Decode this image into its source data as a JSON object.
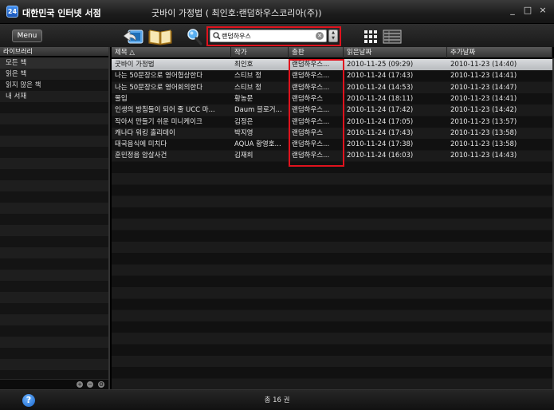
{
  "app": {
    "name": "대한민국 인터넷 서점",
    "logo_text": "24",
    "window_title": "굿바이 가정법 ( 최인호:랜덤하우스코리아(주))"
  },
  "window_controls": {
    "minimize": "_",
    "maximize": "□",
    "close": "×"
  },
  "toolbar": {
    "menu_label": "Menu",
    "search_value": "랜덤하우스",
    "search_placeholder": ""
  },
  "sidebar": {
    "header": "라이브러리",
    "items": [
      {
        "label": "모든 책",
        "selected": true
      },
      {
        "label": "읽은 책",
        "selected": false
      },
      {
        "label": "읽지 않은 책",
        "selected": false
      },
      {
        "label": "내 서재",
        "selected": false
      }
    ],
    "footer_buttons": [
      "+",
      "−",
      "⚙"
    ]
  },
  "table": {
    "columns": [
      "제목 △",
      "작가",
      "출판",
      "읽은날짜",
      "추가날짜"
    ],
    "rows": [
      [
        "굿바이 가정법",
        "최인호",
        "랜덤하우스...",
        "2010-11-25 (09:29)",
        "2010-11-23 (14:40)"
      ],
      [
        "나는 50문장으로 영어협상한다",
        "스티브 정",
        "랜덤하우스...",
        "2010-11-24 (17:43)",
        "2010-11-23 (14:41)"
      ],
      [
        "나는 50문장으로 영어회의한다",
        "스티브 정",
        "랜덤하우스...",
        "2010-11-24 (14:53)",
        "2010-11-23 (14:47)"
      ],
      [
        "몰입",
        "황농문",
        "랜덤하우스",
        "2010-11-24 (18:11)",
        "2010-11-23 (14:41)"
      ],
      [
        "인생의 방침들이 되어 줄 UCC 마...",
        "Daum 블로거...",
        "랜덤하우스...",
        "2010-11-24 (17:42)",
        "2010-11-23 (14:42)"
      ],
      [
        "작아서 만들기 쉬운 미니케이크",
        "김정은",
        "랜덤하우스...",
        "2010-11-24 (17:05)",
        "2010-11-23 (13:57)"
      ],
      [
        "캐나다 워킹 홀리데이",
        "박지영",
        "랜덤하우스",
        "2010-11-24 (17:43)",
        "2010-11-23 (13:58)"
      ],
      [
        "태국음식에 미치다",
        "AQUA 황영호...",
        "랜덤하우스...",
        "2010-11-24 (17:38)",
        "2010-11-23 (13:58)"
      ],
      [
        "훈민정음 암살사건",
        "김재희",
        "랜덤하우스...",
        "2010-11-24 (16:03)",
        "2010-11-23 (14:43)"
      ]
    ],
    "selected_row": 0
  },
  "status": {
    "total_label": "총 16 권",
    "help": "?"
  },
  "colors": {
    "highlight_red": "#e0121d",
    "selected_row": "#c8cacd",
    "accent_blue": "#1663c8"
  }
}
